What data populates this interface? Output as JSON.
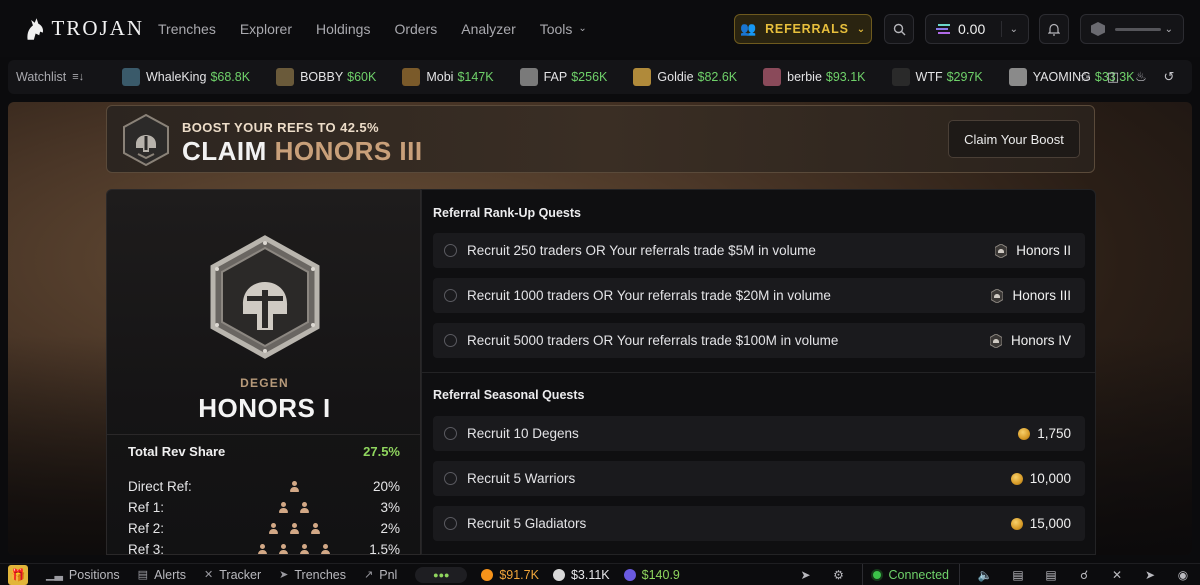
{
  "brand": {
    "name": "TROJAN"
  },
  "nav": {
    "links": [
      {
        "label": "Trenches"
      },
      {
        "label": "Explorer"
      },
      {
        "label": "Holdings"
      },
      {
        "label": "Orders"
      },
      {
        "label": "Analyzer"
      },
      {
        "label": "Tools"
      }
    ],
    "referrals_label": "REFERRALS",
    "balance": "0.00"
  },
  "watchlist": {
    "label": "Watchlist",
    "items": [
      {
        "name": "WhaleKing",
        "value": "$68.8K",
        "color": "#3a5a6a"
      },
      {
        "name": "BOBBY",
        "value": "$60K",
        "color": "#6a5a3a"
      },
      {
        "name": "Mobi",
        "value": "$147K",
        "color": "#7a5a2a"
      },
      {
        "name": "FAP",
        "value": "$256K",
        "color": "#7a7a7a"
      },
      {
        "name": "Goldie",
        "value": "$82.6K",
        "color": "#b08a3a"
      },
      {
        "name": "berbie",
        "value": "$93.1K",
        "color": "#8a4a5a"
      },
      {
        "name": "WTF",
        "value": "$297K",
        "color": "#2a2a2a"
      },
      {
        "name": "YAOMING",
        "value": "$33.3K",
        "color": "#8a8a8a"
      }
    ]
  },
  "banner": {
    "subtitle": "BOOST YOUR REFS TO 42.5%",
    "title_prefix": "CLAIM",
    "title_rank": "HONORS III",
    "button": "Claim Your Boost"
  },
  "rank": {
    "tier": "DEGEN",
    "name": "HONORS I",
    "rev_share_label": "Total Rev Share",
    "rev_share_value": "27.5%",
    "refs": [
      {
        "label": "Direct Ref:",
        "people": 1,
        "pct": "20%"
      },
      {
        "label": "Ref 1:",
        "people": 2,
        "pct": "3%"
      },
      {
        "label": "Ref 2:",
        "people": 3,
        "pct": "2%"
      },
      {
        "label": "Ref 3:",
        "people": 4,
        "pct": "1.5%"
      }
    ]
  },
  "rankup": {
    "heading": "Referral Rank-Up Quests",
    "quests": [
      {
        "text": "Recruit 250 traders OR Your referrals trade $5M in volume",
        "reward": "Honors II"
      },
      {
        "text": "Recruit 1000 traders OR Your referrals trade $20M in volume",
        "reward": "Honors III"
      },
      {
        "text": "Recruit 5000 traders OR Your referrals trade $100M in volume",
        "reward": "Honors IV"
      }
    ]
  },
  "seasonal": {
    "heading": "Referral Seasonal Quests",
    "quests": [
      {
        "text": "Recruit 10 Degens",
        "reward": "1,750"
      },
      {
        "text": "Recruit 5 Warriors",
        "reward": "10,000"
      },
      {
        "text": "Recruit 5 Gladiators",
        "reward": "15,000"
      }
    ]
  },
  "bottom": {
    "items": [
      {
        "label": "Positions",
        "icon": "chart-icon"
      },
      {
        "label": "Alerts",
        "icon": "calendar-icon"
      },
      {
        "label": "Tracker",
        "icon": "x-icon"
      },
      {
        "label": "Trenches",
        "icon": "rocket-icon"
      },
      {
        "label": "Pnl",
        "icon": "trend-icon"
      }
    ],
    "prices": [
      {
        "value": "$91.7K",
        "color": "#f7931a",
        "text_color": "#f0a53a"
      },
      {
        "value": "$3.11K",
        "color": "#d8d8d8",
        "text_color": "#e8e8ea"
      },
      {
        "value": "$140.9",
        "color": "#6a5ae0",
        "text_color": "#8fd55e"
      }
    ],
    "status": "Connected"
  }
}
